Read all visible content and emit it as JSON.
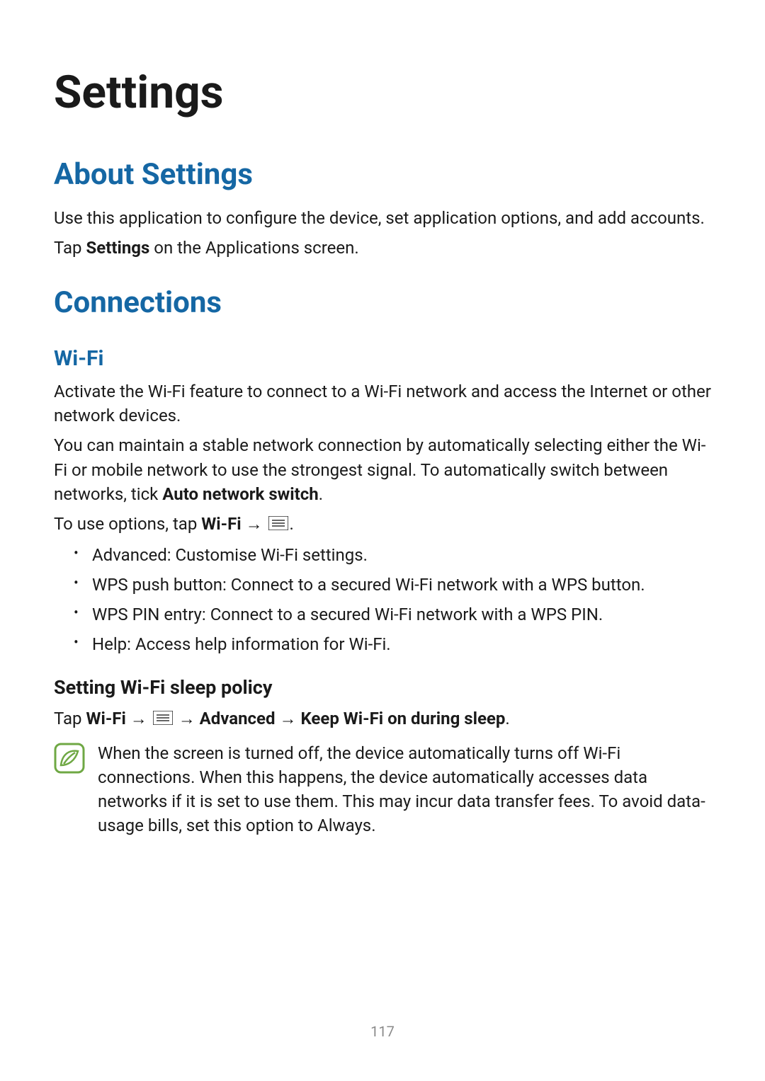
{
  "pageNumber": "117",
  "h1": "Settings",
  "about": {
    "heading": "About Settings",
    "p1": "Use this application to configure the device, set application options, and add accounts.",
    "p2_pre": "Tap ",
    "p2_bold": "Settings",
    "p2_post": " on the Applications screen."
  },
  "connections": {
    "heading": "Connections",
    "wifi": {
      "heading": "Wi-Fi",
      "p1": "Activate the Wi-Fi feature to connect to a Wi-Fi network and access the Internet or other network devices.",
      "p2_pre": "You can maintain a stable network connection by automatically selecting either the Wi-Fi or mobile network to use the strongest signal. To automatically switch between networks, tick ",
      "p2_bold": "Auto network switch",
      "p2_post": ".",
      "options_pre": "To use options, tap ",
      "options_bold1": "Wi-Fi",
      "options_arrow": " → ",
      "options_post": ".",
      "bullets": [
        {
          "bold": "Advanced",
          "text": ": Customise Wi-Fi settings."
        },
        {
          "bold": "WPS push button",
          "text": ": Connect to a secured Wi-Fi network with a WPS button."
        },
        {
          "bold": "WPS PIN entry",
          "text": ": Connect to a secured Wi-Fi network with a WPS PIN."
        },
        {
          "bold": "Help",
          "text": ": Access help information for Wi-Fi."
        }
      ],
      "sleep": {
        "heading": "Setting Wi-Fi sleep policy",
        "path_pre": "Tap ",
        "path_b1": "Wi-Fi",
        "arrow": " → ",
        "path_b2": "Advanced",
        "path_b3": "Keep Wi-Fi on during sleep",
        "path_post": ".",
        "note_pre": "When the screen is turned off, the device automatically turns off Wi-Fi connections. When this happens, the device automatically accesses data networks if it is set to use them. This may incur data transfer fees. To avoid data-usage bills, set this option to ",
        "note_bold": "Always",
        "note_post": "."
      }
    }
  }
}
